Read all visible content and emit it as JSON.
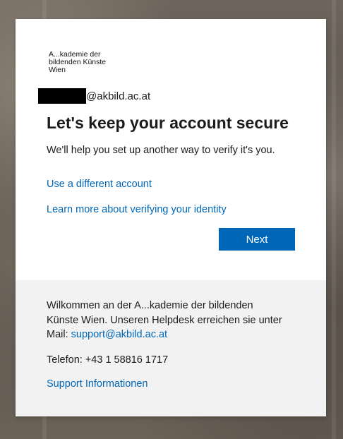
{
  "logo": {
    "line1": "A...kademie der",
    "line2": "bildenden Künste",
    "line3": "Wien"
  },
  "identity": {
    "email_suffix": "@akbild.ac.at"
  },
  "page": {
    "title": "Let's keep your account secure",
    "description": "We'll help you set up another way to verify it's you."
  },
  "links": {
    "different_account": "Use a different account",
    "learn_more": "Learn more about verifying your identity"
  },
  "buttons": {
    "next": "Next"
  },
  "footer": {
    "welcome_text": "Wilkommen an der A...kademie der bildenden Künste Wien. Unseren Helpdesk erreichen sie unter Mail: ",
    "support_email": "support@akbild.ac.at",
    "phone": "Telefon: +43 1 58816 1717",
    "support_link": "Support Informationen"
  },
  "colors": {
    "accent": "#0067b8",
    "footer_bg": "#f2f2f2",
    "text": "#1b1b1b"
  }
}
